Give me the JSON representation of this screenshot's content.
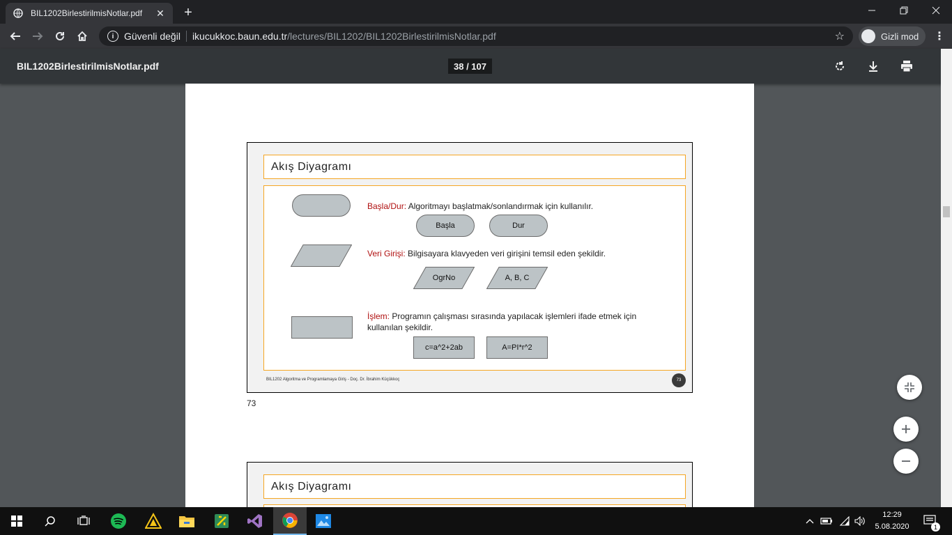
{
  "browser": {
    "tab_title": "BIL1202BirlestirilmisNotlar.pdf",
    "security_label": "Güvenli değil",
    "url_host": "ikucukkoc.baun.edu.tr",
    "url_path": "/lectures/BIL1202/BIL1202BirlestirilmisNotlar.pdf",
    "incognito_label": "Gizli mod"
  },
  "pdf_viewer": {
    "file_name": "BIL1202BirlestirilmisNotlar.pdf",
    "page_indicator": "38 / 107"
  },
  "slide1": {
    "title": "Akış Diyagramı",
    "items": [
      {
        "key": "Başla/Dur:",
        "text": " Algoritmayı başlatmak/sonlandırmak için kullanılır.",
        "examples": [
          "Başla",
          "Dur"
        ]
      },
      {
        "key": "Veri Girişi:",
        "text": " Bilgisayara klavyeden veri girişini temsil eden şekildir.",
        "examples": [
          "OgrNo",
          "A, B, C"
        ]
      },
      {
        "key": "İşlem:",
        "text": " Programın çalışması sırasında yapılacak işlemleri ifade etmek için kullanılan şekildir.",
        "examples": [
          "c=a^2+2ab",
          "A=PI*r^2"
        ]
      }
    ],
    "footer": "BIL1202 Algoritma ve Programlamaya Giriş - Doç. Dr. İbrahim Küçükkoç",
    "slide_number": "73"
  },
  "page_label": "73",
  "slide2": {
    "title": "Akış Diyagramı"
  },
  "taskbar": {
    "time": "12:29",
    "date": "5.08.2020",
    "notification_count": "1"
  }
}
